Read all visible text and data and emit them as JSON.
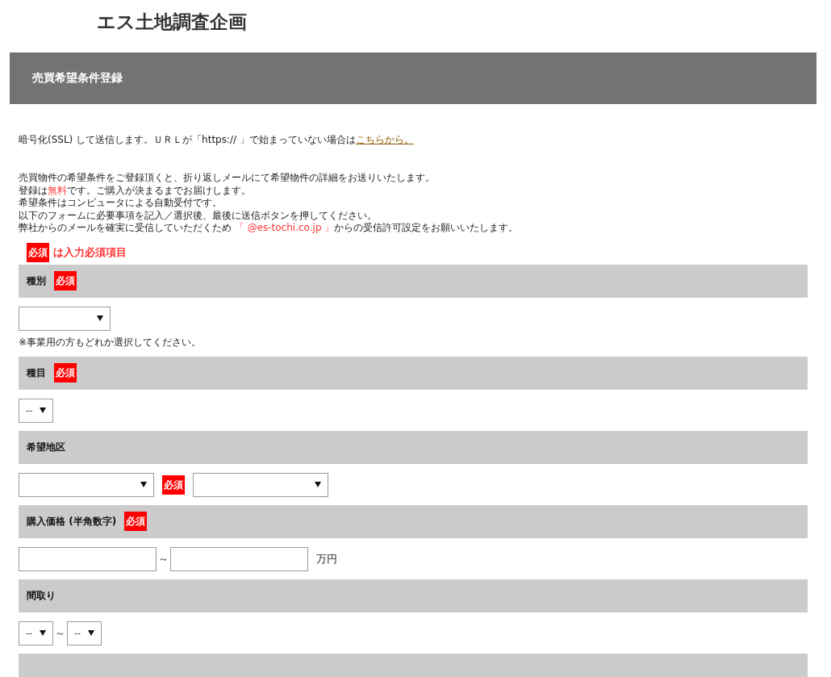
{
  "site": {
    "logo": "エス土地調査企画"
  },
  "page_header": {
    "title": "売買希望条件登録"
  },
  "ssl_notice": {
    "text": "暗号化(SSL) して送信します。ＵＲＬが「https:// 」で始まっていない場合は",
    "link": "こちらから。"
  },
  "intro_lines": [
    [
      {
        "text": "売買物件の希望条件をご登録頂くと、折り返しメールにて希望物件の詳細をお送りいたします。",
        "highlight": false
      }
    ],
    [
      {
        "text": "登録は",
        "highlight": false
      },
      {
        "text": "無料",
        "highlight": true
      },
      {
        "text": "です。ご購入が決まるまでお届けします。",
        "highlight": false
      }
    ],
    [
      {
        "text": "希望条件はコンピュータによる自動受付です。",
        "highlight": false
      }
    ],
    [
      {
        "text": "以下のフォームに必要事項を記入／選択後、最後に送信ボタンを押してください。",
        "highlight": false
      }
    ],
    [
      {
        "text": "弊社からのメールを確実に受信していただくため ",
        "highlight": false
      },
      {
        "text": "「 @es-tochi.co.jp 」",
        "highlight": true
      },
      {
        "text": "からの受信許可設定をお願いいたします。",
        "highlight": false
      }
    ]
  ],
  "required_legend": {
    "badge": "必須",
    "text": "は入力必須項目"
  },
  "sections": [
    {
      "label": "種別",
      "required_badge": "必須",
      "fields": [
        {
          "kind": "select"
        }
      ],
      "note": "※事業用の方もどれか選択してください。"
    },
    {
      "label": "種目",
      "required_badge": "必須",
      "fields": [
        {
          "kind": "select",
          "value": "--"
        }
      ]
    },
    {
      "label": "希望地区",
      "fields": [
        {
          "kind": "select"
        },
        {
          "kind": "badge",
          "text": "必須"
        },
        {
          "kind": "select"
        }
      ]
    },
    {
      "label": "購入価格 (半角数字)",
      "required_badge": "必須",
      "fields": [
        {
          "kind": "input"
        },
        {
          "kind": "separator",
          "text": "～"
        },
        {
          "kind": "input"
        },
        {
          "kind": "unit",
          "text": "万円"
        }
      ]
    },
    {
      "label": "間取り",
      "fields": [
        {
          "kind": "select",
          "value": "--"
        },
        {
          "kind": "separator",
          "text": "～"
        },
        {
          "kind": "select",
          "value": "--"
        }
      ]
    }
  ]
}
